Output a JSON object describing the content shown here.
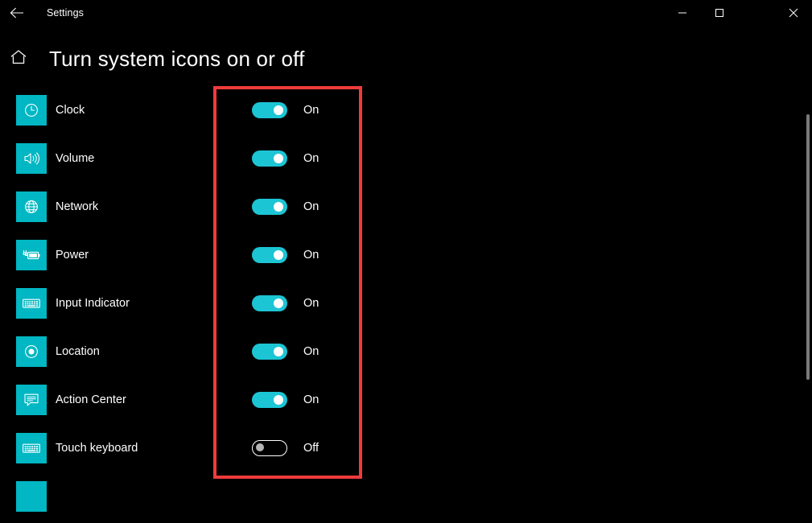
{
  "window": {
    "app_title": "Settings",
    "back_icon": "back-arrow-icon",
    "controls": {
      "minimize": "minimize-icon",
      "maximize": "maximize-icon",
      "close": "close-icon"
    }
  },
  "header": {
    "home_icon": "home-icon",
    "title": "Turn system icons on or off"
  },
  "rows": [
    {
      "icon": "clock-icon",
      "label": "Clock",
      "state": "On",
      "on": true
    },
    {
      "icon": "volume-icon",
      "label": "Volume",
      "state": "On",
      "on": true
    },
    {
      "icon": "network-globe-icon",
      "label": "Network",
      "state": "On",
      "on": true
    },
    {
      "icon": "power-battery-icon",
      "label": "Power",
      "state": "On",
      "on": true
    },
    {
      "icon": "keyboard-icon",
      "label": "Input Indicator",
      "state": "On",
      "on": true
    },
    {
      "icon": "location-icon",
      "label": "Location",
      "state": "On",
      "on": true
    },
    {
      "icon": "action-center-icon",
      "label": "Action Center",
      "state": "On",
      "on": true
    },
    {
      "icon": "touch-keyboard-icon",
      "label": "Touch keyboard",
      "state": "Off",
      "on": false
    }
  ],
  "colors": {
    "background": "#000000",
    "icon_tile": "#00b7c3",
    "toggle_on": "#1cc5d4",
    "annotation": "#ef3b3b",
    "text": "#ffffff"
  },
  "annotation": {
    "shape": "rectangle",
    "color": "#ef3b3b"
  }
}
